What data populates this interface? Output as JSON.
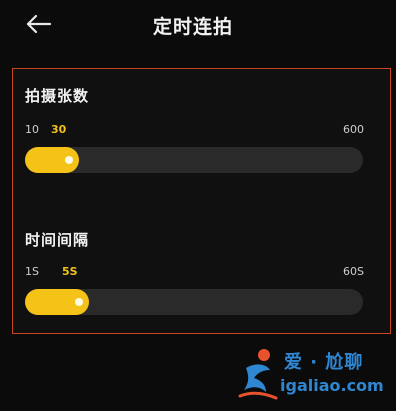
{
  "header": {
    "title": "定时连拍",
    "back_icon": "arrow-left-icon"
  },
  "shot_count": {
    "title": "拍摄张数",
    "min_label": "10",
    "current_label": "30",
    "max_label": "600",
    "min": 10,
    "max": 600,
    "value": 30
  },
  "interval": {
    "title": "时间间隔",
    "min_label": "1S",
    "current_label": "5S",
    "max_label": "60S",
    "min": 1,
    "max": 60,
    "value": 5
  },
  "watermark": {
    "text_cn": "爱 · 尬聊",
    "url": "igaliao.com"
  },
  "colors": {
    "accent": "#f5c218",
    "border": "#c5451e",
    "track": "#2a2a2a",
    "watermark": "#2f86d1"
  }
}
